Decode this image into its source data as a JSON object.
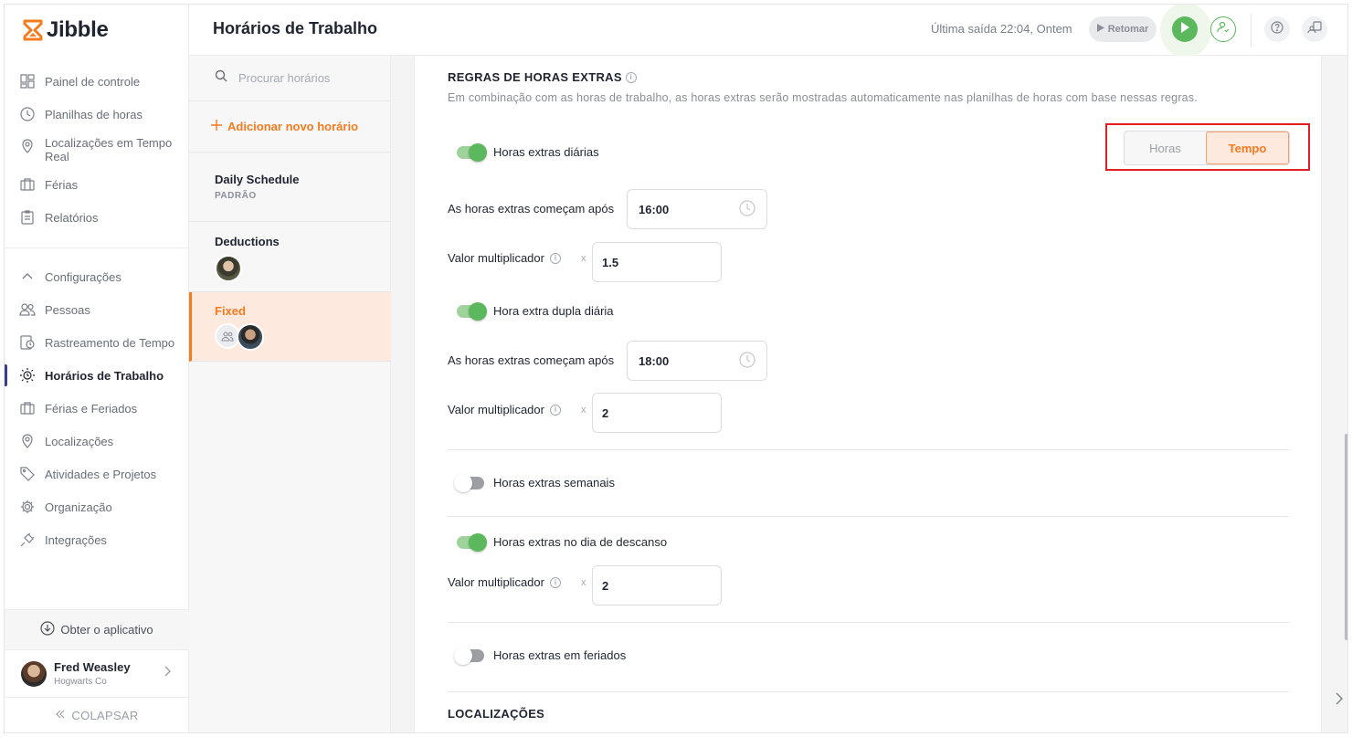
{
  "app": {
    "brand": "Jibble",
    "brand_color": "#f47b20"
  },
  "sidebar": {
    "items_top": [
      {
        "label": "Painel de controle",
        "icon": "dashboard-icon"
      },
      {
        "label": "Planilhas de horas",
        "icon": "clock-icon"
      },
      {
        "label": "Localizações em Tempo Real",
        "icon": "location-pin-icon"
      },
      {
        "label": "Férias",
        "icon": "suitcase-icon"
      },
      {
        "label": "Relatórios",
        "icon": "clipboard-icon"
      }
    ],
    "settings_header": "Configurações",
    "items_settings": [
      {
        "label": "Pessoas",
        "icon": "people-icon"
      },
      {
        "label": "Rastreamento de Tempo",
        "icon": "time-tracking-icon"
      },
      {
        "label": "Horários de Trabalho",
        "icon": "work-schedule-icon",
        "active": true
      },
      {
        "label": "Férias e Feriados",
        "icon": "suitcase-icon"
      },
      {
        "label": "Localizações",
        "icon": "location-pin-icon"
      },
      {
        "label": "Atividades e Projetos",
        "icon": "tag-icon"
      },
      {
        "label": "Organização",
        "icon": "gear-icon"
      },
      {
        "label": "Integrações",
        "icon": "plug-icon"
      }
    ],
    "get_app": "Obter o aplicativo",
    "user": {
      "name": "Fred Weasley",
      "org": "Hogwarts Co"
    },
    "collapse": "COLAPSAR"
  },
  "header": {
    "title": "Horários de Trabalho",
    "last_out": "Última saída 22:04, Ontem",
    "resume": "Retomar"
  },
  "schedules": {
    "search_placeholder": "Procurar horários",
    "add_new": "Adicionar novo horário",
    "items": [
      {
        "name": "Daily Schedule",
        "tag": "PADRÃO"
      },
      {
        "name": "Deductions"
      },
      {
        "name": "Fixed",
        "active": true
      }
    ]
  },
  "overtime": {
    "title": "REGRAS DE HORAS EXTRAS",
    "description": "Em combinação com as horas de trabalho, as horas extras serão mostradas automaticamente nas planilhas de horas com base nessas regras.",
    "segmented": {
      "option_hours": "Horas",
      "option_time": "Tempo",
      "selected": "Tempo"
    },
    "daily": {
      "label": "Horas extras diárias",
      "enabled": true,
      "starts_after_label": "As horas extras começam após",
      "starts_after": "16:00",
      "multiplier_label": "Valor multiplicador",
      "multiplier": "1.5"
    },
    "daily_double": {
      "label": "Hora extra dupla diária",
      "enabled": true,
      "starts_after_label": "As horas extras começam após",
      "starts_after": "18:00",
      "multiplier_label": "Valor multiplicador",
      "multiplier": "2"
    },
    "weekly": {
      "label": "Horas extras semanais",
      "enabled": false
    },
    "rest_day": {
      "label": "Horas extras no dia de descanso",
      "enabled": true,
      "multiplier_label": "Valor multiplicador",
      "multiplier": "2"
    },
    "holidays": {
      "label": "Horas extras em feriados",
      "enabled": false
    },
    "times_symbol": "x"
  },
  "locations": {
    "title": "LOCALIZAÇÕES"
  }
}
